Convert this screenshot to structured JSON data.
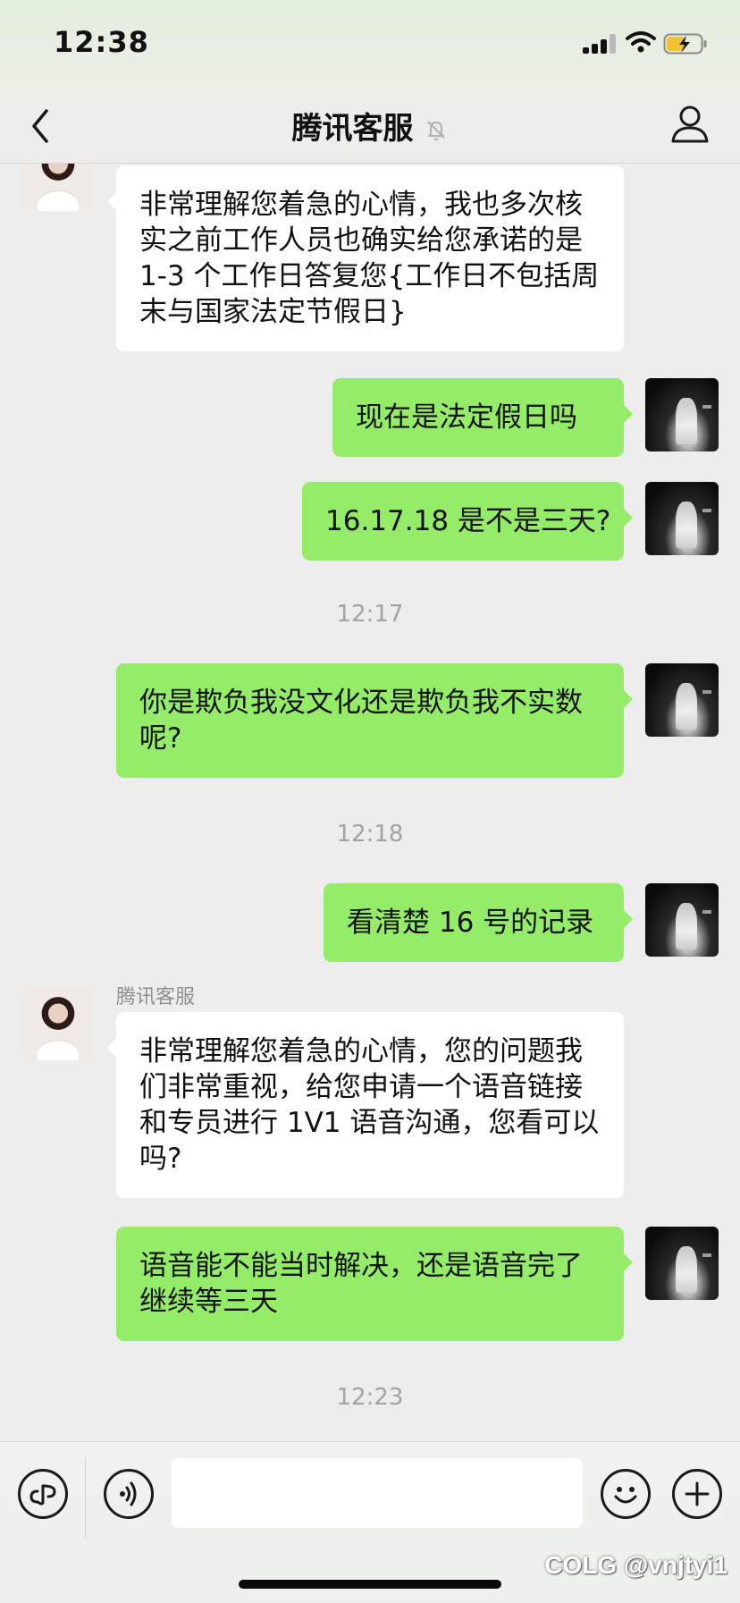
{
  "status_bar": {
    "time": "12:38"
  },
  "header": {
    "back_icon": "chevron-left-icon",
    "title": "腾讯客服",
    "mute_icon": "bell-off-icon",
    "profile_icon": "person-icon"
  },
  "chat": {
    "msg_agent_top": "非常理解您着急的心情，我也多次核实之前工作人员也确实给您承诺的是 1-3 个工作日答复您{工作日不包括周末与国家法定节假日}",
    "msg_user_holiday": "现在是法定假日吗",
    "msg_user_three_days": "16.17.18 是不是三天?",
    "time_1217": "12:17",
    "msg_user_bully": "你是欺负我没文化还是欺负我不实数呢?",
    "time_1218": "12:18",
    "msg_user_record": "看清楚 16 号的记录",
    "sender_name": "腾讯客服",
    "msg_agent_voice": "非常理解您着急的心情，您的问题我们非常重视，给您申请一个语音链接和专员进行 1V1 语音沟通，您看可以吗?",
    "msg_user_voice": "语音能不能当时解决，还是语音完了继续等三天",
    "time_1223": "12:23"
  },
  "input_bar": {
    "mini_program_icon": "link-icon",
    "voice_icon": "voice-icon",
    "input_value": "",
    "emoji_icon": "emoji-icon",
    "plus_icon": "plus-icon"
  },
  "watermark": "COLG @vnjtyi1",
  "colors": {
    "background": "#ededed",
    "bubble_out": "#95ec69",
    "bubble_in": "#ffffff",
    "timestamp": "#a3a3a3"
  }
}
